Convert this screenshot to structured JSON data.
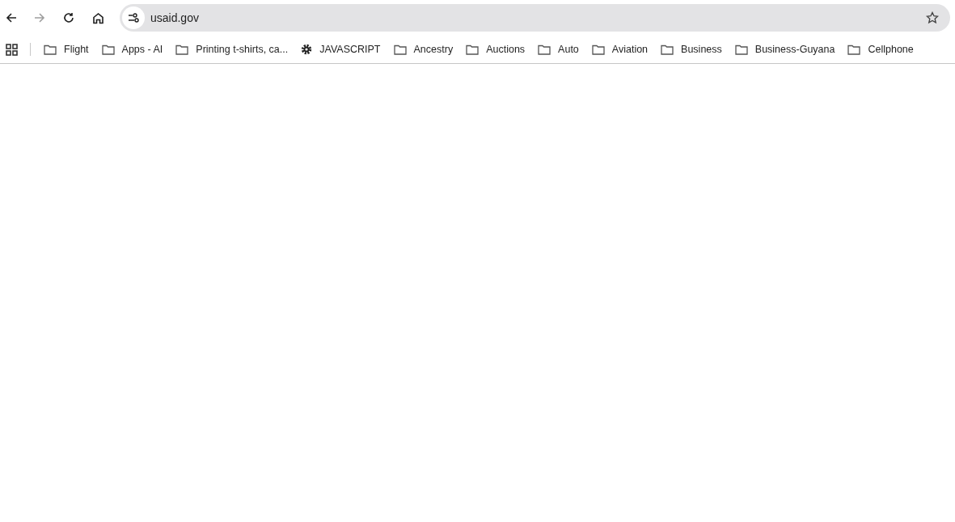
{
  "toolbar": {
    "back": {
      "disabled": false
    },
    "forward": {
      "disabled": true
    },
    "address": "usaid.gov"
  },
  "bookmarks": [
    {
      "label": "Flight",
      "kind": "folder"
    },
    {
      "label": "Apps - AI",
      "kind": "folder"
    },
    {
      "label": "Printing t-shirts, ca...",
      "kind": "folder"
    },
    {
      "label": "JAVASCRIPT",
      "kind": "gear"
    },
    {
      "label": "Ancestry",
      "kind": "folder"
    },
    {
      "label": "Auctions",
      "kind": "folder"
    },
    {
      "label": "Auto",
      "kind": "folder"
    },
    {
      "label": "Aviation",
      "kind": "folder"
    },
    {
      "label": "Business",
      "kind": "folder"
    },
    {
      "label": "Business-Guyana",
      "kind": "folder"
    },
    {
      "label": "Cellphone",
      "kind": "folder"
    }
  ]
}
